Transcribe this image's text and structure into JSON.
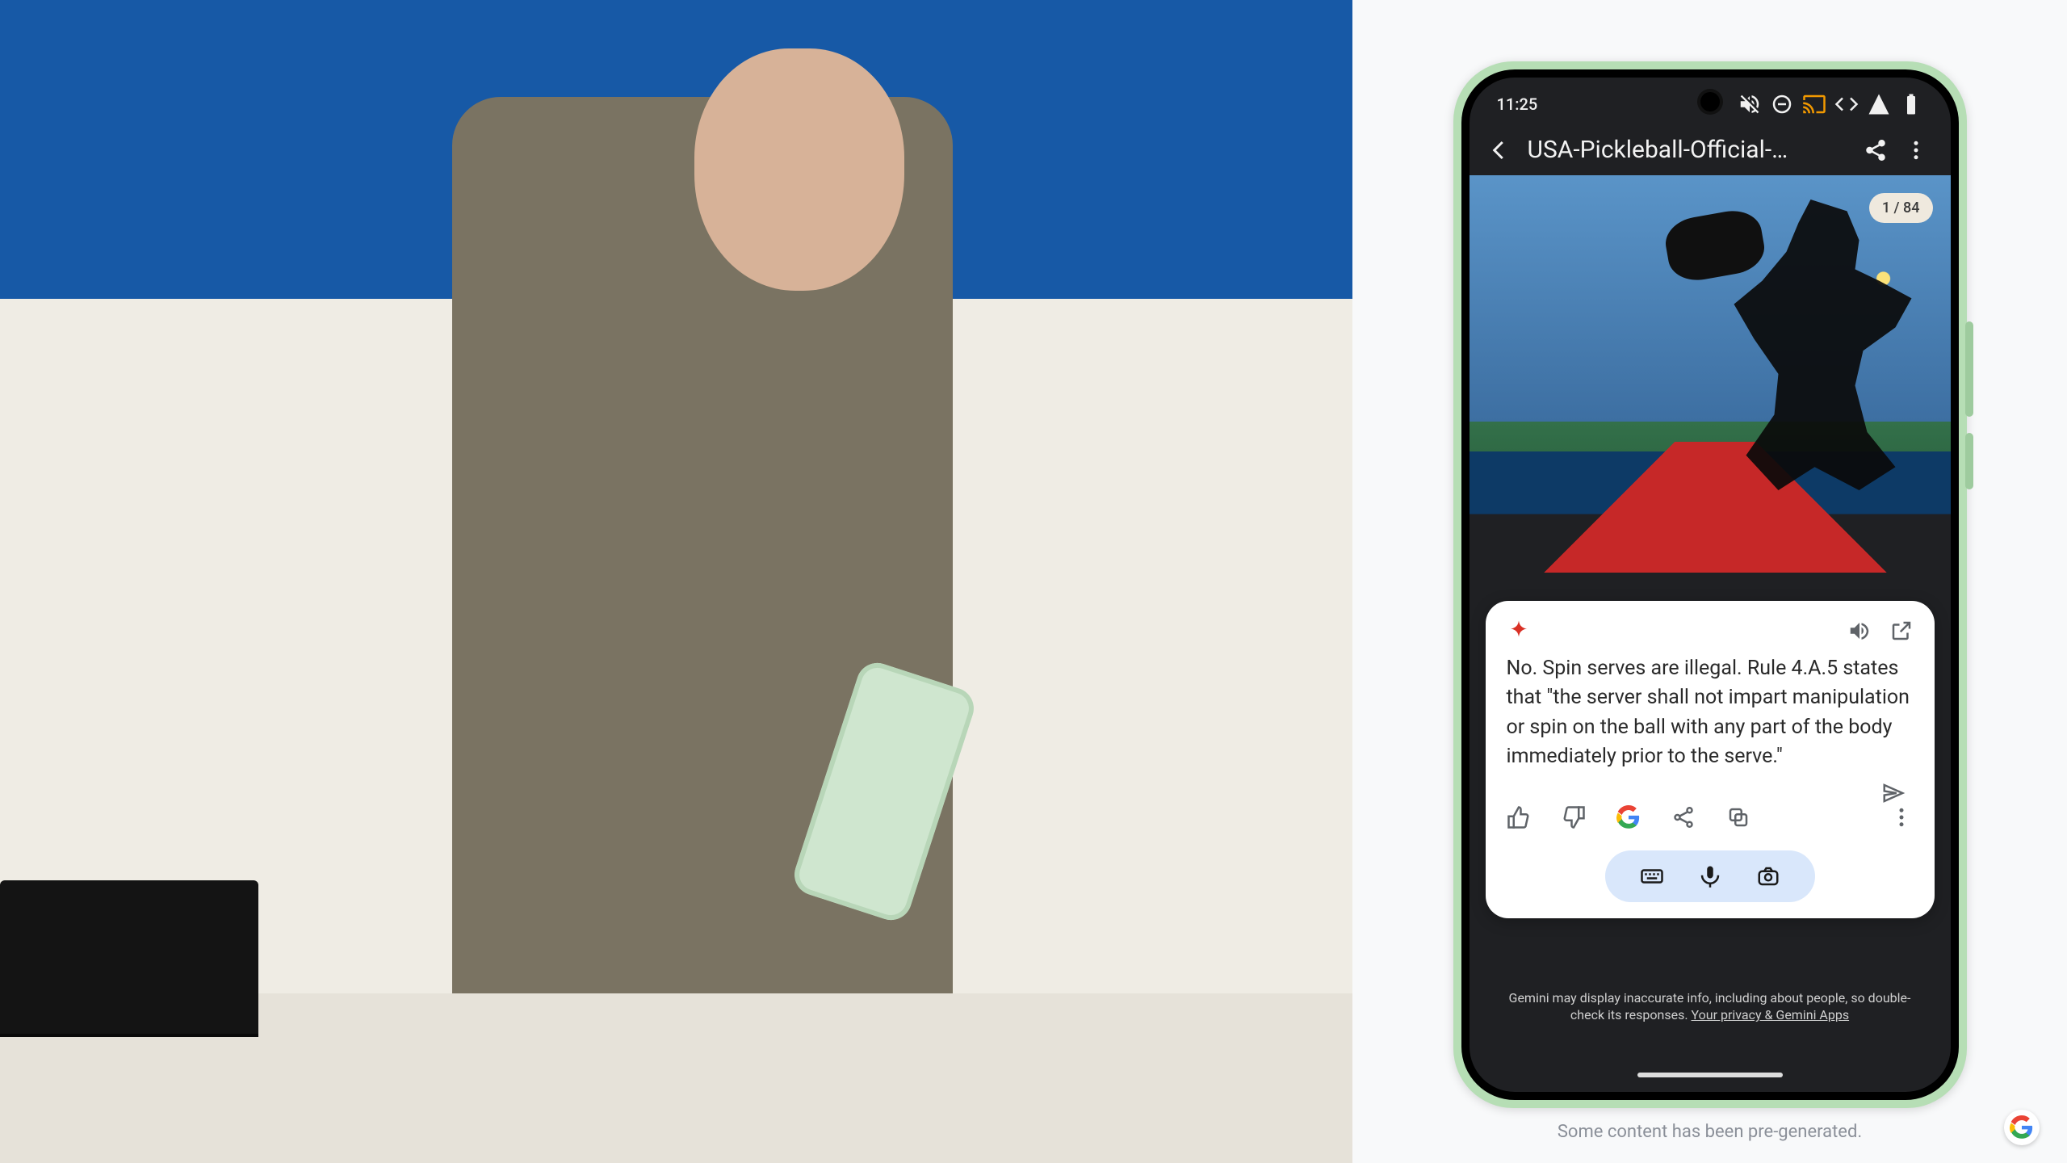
{
  "phone": {
    "status": {
      "time": "11:25"
    },
    "titlebar": {
      "document_title": "USA-Pickleball-Official-…"
    },
    "hero": {
      "page_chip": "1 / 84"
    },
    "gemini_response": {
      "answer": "No. Spin serves are illegal. Rule 4.A.5 states that \"the server shall not impart manipulation or spin on the ball with any part of the body immediately prior to the serve.\""
    },
    "disclaimer": {
      "text": "Gemini may display inaccurate info, including about people, so double-check its responses. ",
      "link_text": "Your privacy & Gemini Apps"
    }
  },
  "right_caption": "Some content has been pre-generated."
}
